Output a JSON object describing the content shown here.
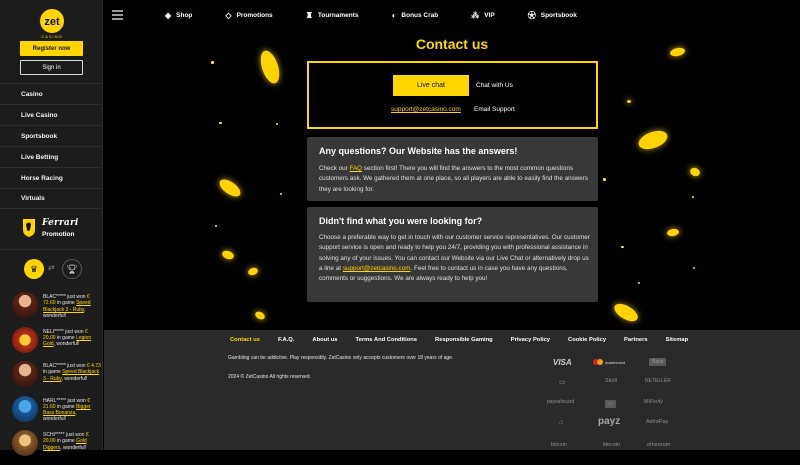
{
  "brand": {
    "logo_text": "zet",
    "logo_sub": "CASINO"
  },
  "sidebar": {
    "register_label": "Register now",
    "signin_label": "Sign in",
    "items": [
      {
        "label": "Casino"
      },
      {
        "label": "Live Casino"
      },
      {
        "label": "Sportsbook"
      },
      {
        "label": "Live Betting"
      },
      {
        "label": "Horse Racing"
      },
      {
        "label": "Virtuals"
      }
    ],
    "promo": {
      "brand": "Ferrari",
      "label": "Promotion"
    },
    "wins": [
      {
        "name": "BLAC*****",
        "verb": "just won",
        "amount": "€ 72.60",
        "game": "Speed Blackjack 3 - Ruby",
        "suffix": "wonderful!"
      },
      {
        "name": "NELI*****",
        "verb": "just won",
        "amount": "€ 20.00",
        "game": "Legion Gold",
        "suffix": "wonderful!"
      },
      {
        "name": "BLAC*****",
        "verb": "just won",
        "amount": "€ 4.73",
        "game": "Speed Blackjack 3 - Ruby",
        "suffix": "wonderful!"
      },
      {
        "name": "HARL*****",
        "verb": "just won",
        "amount": "€ 21.60",
        "game": "Bigger Bass Bonanza",
        "suffix": "wonderful!"
      },
      {
        "name": "SCHI*****",
        "verb": "just won",
        "amount": "€ 20.00",
        "game": "Gold Diggers",
        "suffix": "wonderful!"
      }
    ]
  },
  "topnav": [
    {
      "label": "Shop",
      "icon": "tag-icon"
    },
    {
      "label": "Promotions",
      "icon": "diamond-icon"
    },
    {
      "label": "Tournaments",
      "icon": "trophy-icon"
    },
    {
      "label": "Bonus Crab",
      "icon": "crab-icon"
    },
    {
      "label": "VIP",
      "icon": "vip-icon"
    },
    {
      "label": "Sportsbook",
      "icon": "football-icon"
    }
  ],
  "main": {
    "title": "Contact us",
    "live_chat_label": "Live chat",
    "chat_with_label": "Chat with Us",
    "email": "support@zetcasino.com",
    "email_label": "Email Support",
    "faq_card": {
      "heading": "Any questions? Our Website has the answers!",
      "pre": "Check our ",
      "link": "FAQ",
      "post": " section first! There you will find the answers to the most common questions customers ask. We gathered them at one place, so all players are able to easily find the answers they are looking for."
    },
    "help_card": {
      "heading": "Didn't find what you were looking for?",
      "pre": "Choose a preferable way to get in touch with our customer service representatives. Our customer support service is open and ready to help you 24/7, providing you with professional assistance in solving any of your issues. You can contact our Website via our Live Chat or alternatively drop us a line at ",
      "link": "support@zetcasino.com",
      "post": ". Feel free to contact us in case you have any questions, comments or suggestions. We are always ready to help you!"
    }
  },
  "footer": {
    "links": [
      "Contact us",
      "F.A.Q.",
      "About us",
      "Terms And Conditions",
      "Responsible Gaming",
      "Privacy Policy",
      "Cookie Policy",
      "Partners",
      "Sitemap"
    ],
    "disclaimer": "Gambling can be addictive. Play responsibly. ZetCasino only accepts customers over 18 years of age.",
    "copyright": "2024 © ZetCasino All rights reserved.",
    "payments": {
      "visa": "VISA",
      "mastercard": "mastercard",
      "bank": "Bank",
      "skrill": "Skrill",
      "neteller": "NETELLER",
      "paysafe": "paysafecard",
      "mifinity": "MiFinity",
      "payz": "payz",
      "astropay": "AstroPay",
      "bitcoin": "bitcoin",
      "litecoin": "litecoin",
      "ethereum": "ethereum"
    }
  },
  "colors": {
    "accent": "#ffd600",
    "sidebar_bg": "#1c1c1c",
    "card_bg": "#383838",
    "footer_bg": "#2a2a2a"
  }
}
